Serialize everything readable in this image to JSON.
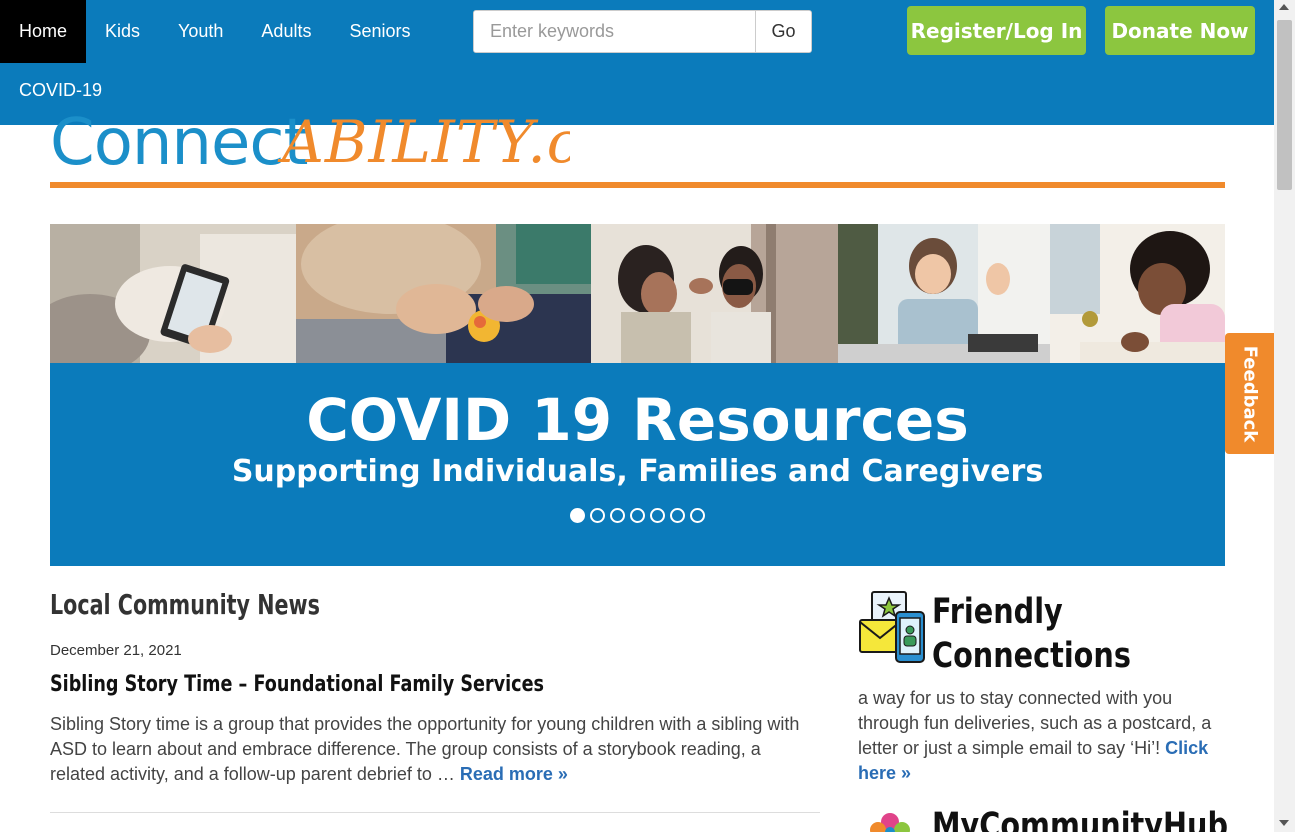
{
  "nav": {
    "items": [
      {
        "label": "Home",
        "active": true
      },
      {
        "label": "Kids"
      },
      {
        "label": "Youth"
      },
      {
        "label": "Adults"
      },
      {
        "label": "Seniors"
      }
    ],
    "covid_label": "COVID-19"
  },
  "search": {
    "placeholder": "Enter keywords",
    "button_label": "Go"
  },
  "actions": {
    "register_label": "Register/Log In",
    "donate_label": "Donate Now"
  },
  "logo": {
    "part1": "Connect",
    "part2": "ABILITY.ca"
  },
  "banner": {
    "title": "COVID 19 Resources",
    "subtitle": "Supporting Individuals, Families and Caregivers",
    "slide_count": 7,
    "active_slide": 1
  },
  "feedback_label": "Feedback",
  "news": {
    "heading": "Local Community News",
    "date": "December 21, 2021",
    "title": "Sibling Story Time – Foundational Family Services",
    "excerpt": "Sibling Story time is a group that provides the opportunity for young children with a sibling with ASD to learn about and embrace difference. The group consists of a storybook reading, a related activity, and a follow-up parent debrief to … ",
    "read_more": "Read more »"
  },
  "sidebar": {
    "friendly": {
      "heading_line1": "Friendly",
      "heading_line2": "Connections",
      "body": "a way for us to stay connected with you through fun deliveries, such as a postcard, a letter or just a simple email to say ‘Hi’! ",
      "link": "Click here »"
    },
    "hub_heading": "MyCommunityHub"
  },
  "colors": {
    "brand_blue": "#0b7bbb",
    "accent_orange": "#f08a2c",
    "accent_green": "#8cc63f",
    "link_blue": "#2a6db5"
  }
}
